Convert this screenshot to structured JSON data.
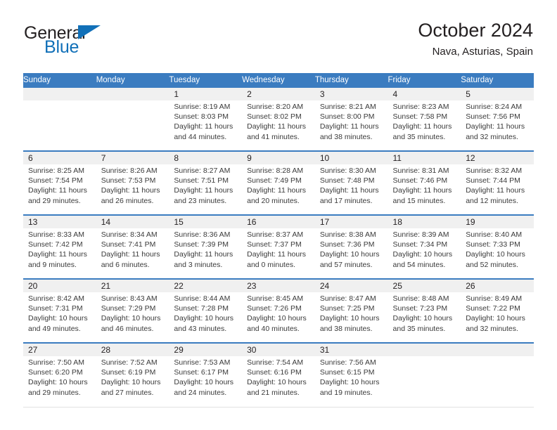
{
  "brand": {
    "name_part1": "General",
    "name_part2": "Blue",
    "accent_color": "#1170b8"
  },
  "header": {
    "title": "October 2024",
    "location": "Nava, Asturias, Spain"
  },
  "calendar": {
    "header_color": "#3b7cc0",
    "weekday_headers": [
      "Sunday",
      "Monday",
      "Tuesday",
      "Wednesday",
      "Thursday",
      "Friday",
      "Saturday"
    ],
    "weeks": [
      [
        {
          "day": "",
          "lines": []
        },
        {
          "day": "",
          "lines": []
        },
        {
          "day": "1",
          "lines": [
            "Sunrise: 8:19 AM",
            "Sunset: 8:03 PM",
            "Daylight: 11 hours",
            "and 44 minutes."
          ]
        },
        {
          "day": "2",
          "lines": [
            "Sunrise: 8:20 AM",
            "Sunset: 8:02 PM",
            "Daylight: 11 hours",
            "and 41 minutes."
          ]
        },
        {
          "day": "3",
          "lines": [
            "Sunrise: 8:21 AM",
            "Sunset: 8:00 PM",
            "Daylight: 11 hours",
            "and 38 minutes."
          ]
        },
        {
          "day": "4",
          "lines": [
            "Sunrise: 8:23 AM",
            "Sunset: 7:58 PM",
            "Daylight: 11 hours",
            "and 35 minutes."
          ]
        },
        {
          "day": "5",
          "lines": [
            "Sunrise: 8:24 AM",
            "Sunset: 7:56 PM",
            "Daylight: 11 hours",
            "and 32 minutes."
          ]
        }
      ],
      [
        {
          "day": "6",
          "lines": [
            "Sunrise: 8:25 AM",
            "Sunset: 7:54 PM",
            "Daylight: 11 hours",
            "and 29 minutes."
          ]
        },
        {
          "day": "7",
          "lines": [
            "Sunrise: 8:26 AM",
            "Sunset: 7:53 PM",
            "Daylight: 11 hours",
            "and 26 minutes."
          ]
        },
        {
          "day": "8",
          "lines": [
            "Sunrise: 8:27 AM",
            "Sunset: 7:51 PM",
            "Daylight: 11 hours",
            "and 23 minutes."
          ]
        },
        {
          "day": "9",
          "lines": [
            "Sunrise: 8:28 AM",
            "Sunset: 7:49 PM",
            "Daylight: 11 hours",
            "and 20 minutes."
          ]
        },
        {
          "day": "10",
          "lines": [
            "Sunrise: 8:30 AM",
            "Sunset: 7:48 PM",
            "Daylight: 11 hours",
            "and 17 minutes."
          ]
        },
        {
          "day": "11",
          "lines": [
            "Sunrise: 8:31 AM",
            "Sunset: 7:46 PM",
            "Daylight: 11 hours",
            "and 15 minutes."
          ]
        },
        {
          "day": "12",
          "lines": [
            "Sunrise: 8:32 AM",
            "Sunset: 7:44 PM",
            "Daylight: 11 hours",
            "and 12 minutes."
          ]
        }
      ],
      [
        {
          "day": "13",
          "lines": [
            "Sunrise: 8:33 AM",
            "Sunset: 7:42 PM",
            "Daylight: 11 hours",
            "and 9 minutes."
          ]
        },
        {
          "day": "14",
          "lines": [
            "Sunrise: 8:34 AM",
            "Sunset: 7:41 PM",
            "Daylight: 11 hours",
            "and 6 minutes."
          ]
        },
        {
          "day": "15",
          "lines": [
            "Sunrise: 8:36 AM",
            "Sunset: 7:39 PM",
            "Daylight: 11 hours",
            "and 3 minutes."
          ]
        },
        {
          "day": "16",
          "lines": [
            "Sunrise: 8:37 AM",
            "Sunset: 7:37 PM",
            "Daylight: 11 hours",
            "and 0 minutes."
          ]
        },
        {
          "day": "17",
          "lines": [
            "Sunrise: 8:38 AM",
            "Sunset: 7:36 PM",
            "Daylight: 10 hours",
            "and 57 minutes."
          ]
        },
        {
          "day": "18",
          "lines": [
            "Sunrise: 8:39 AM",
            "Sunset: 7:34 PM",
            "Daylight: 10 hours",
            "and 54 minutes."
          ]
        },
        {
          "day": "19",
          "lines": [
            "Sunrise: 8:40 AM",
            "Sunset: 7:33 PM",
            "Daylight: 10 hours",
            "and 52 minutes."
          ]
        }
      ],
      [
        {
          "day": "20",
          "lines": [
            "Sunrise: 8:42 AM",
            "Sunset: 7:31 PM",
            "Daylight: 10 hours",
            "and 49 minutes."
          ]
        },
        {
          "day": "21",
          "lines": [
            "Sunrise: 8:43 AM",
            "Sunset: 7:29 PM",
            "Daylight: 10 hours",
            "and 46 minutes."
          ]
        },
        {
          "day": "22",
          "lines": [
            "Sunrise: 8:44 AM",
            "Sunset: 7:28 PM",
            "Daylight: 10 hours",
            "and 43 minutes."
          ]
        },
        {
          "day": "23",
          "lines": [
            "Sunrise: 8:45 AM",
            "Sunset: 7:26 PM",
            "Daylight: 10 hours",
            "and 40 minutes."
          ]
        },
        {
          "day": "24",
          "lines": [
            "Sunrise: 8:47 AM",
            "Sunset: 7:25 PM",
            "Daylight: 10 hours",
            "and 38 minutes."
          ]
        },
        {
          "day": "25",
          "lines": [
            "Sunrise: 8:48 AM",
            "Sunset: 7:23 PM",
            "Daylight: 10 hours",
            "and 35 minutes."
          ]
        },
        {
          "day": "26",
          "lines": [
            "Sunrise: 8:49 AM",
            "Sunset: 7:22 PM",
            "Daylight: 10 hours",
            "and 32 minutes."
          ]
        }
      ],
      [
        {
          "day": "27",
          "lines": [
            "Sunrise: 7:50 AM",
            "Sunset: 6:20 PM",
            "Daylight: 10 hours",
            "and 29 minutes."
          ]
        },
        {
          "day": "28",
          "lines": [
            "Sunrise: 7:52 AM",
            "Sunset: 6:19 PM",
            "Daylight: 10 hours",
            "and 27 minutes."
          ]
        },
        {
          "day": "29",
          "lines": [
            "Sunrise: 7:53 AM",
            "Sunset: 6:17 PM",
            "Daylight: 10 hours",
            "and 24 minutes."
          ]
        },
        {
          "day": "30",
          "lines": [
            "Sunrise: 7:54 AM",
            "Sunset: 6:16 PM",
            "Daylight: 10 hours",
            "and 21 minutes."
          ]
        },
        {
          "day": "31",
          "lines": [
            "Sunrise: 7:56 AM",
            "Sunset: 6:15 PM",
            "Daylight: 10 hours",
            "and 19 minutes."
          ]
        },
        {
          "day": "",
          "lines": []
        },
        {
          "day": "",
          "lines": []
        }
      ]
    ]
  }
}
